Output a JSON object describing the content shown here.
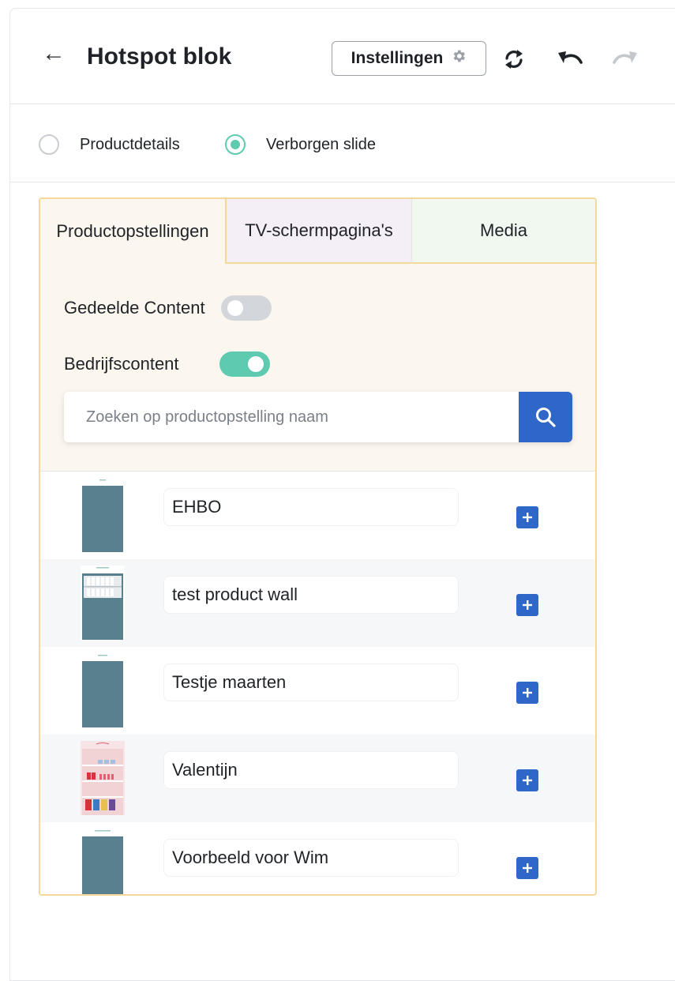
{
  "header": {
    "title": "Hotspot blok",
    "settings_label": "Instellingen"
  },
  "radios": [
    {
      "label": "Productdetails",
      "selected": false
    },
    {
      "label": "Verborgen slide",
      "selected": true
    }
  ],
  "tabs": [
    {
      "label": "Productopstellingen",
      "active": true
    },
    {
      "label": "TV-schermpagina's",
      "active": false
    },
    {
      "label": "Media",
      "active": false
    }
  ],
  "filters": {
    "shared_label": "Gedeelde Content",
    "shared_on": false,
    "company_label": "Bedrijfscontent",
    "company_on": true
  },
  "search": {
    "placeholder": "Zoeken op productopstelling naam",
    "value": ""
  },
  "items": [
    {
      "name": "EHBO"
    },
    {
      "name": "test product wall"
    },
    {
      "name": "Testje maarten"
    },
    {
      "name": "Valentijn"
    },
    {
      "name": "Voorbeeld voor Wim"
    }
  ],
  "colors": {
    "accent": "#5ecbb0",
    "primary": "#2f67c9",
    "tab_border": "#f3d79b"
  }
}
